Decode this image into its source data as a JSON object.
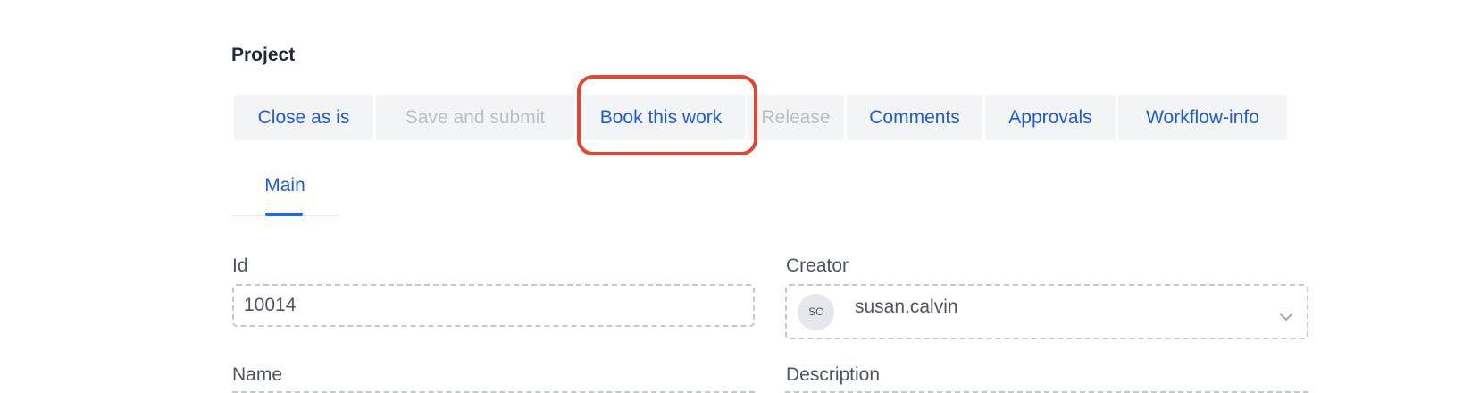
{
  "page": {
    "title": "Project"
  },
  "toolbar": {
    "buttons": [
      {
        "label": "Close as is",
        "enabled": true
      },
      {
        "label": "Save and submit",
        "enabled": false
      },
      {
        "label": "Book this work",
        "enabled": true,
        "highlighted": true
      },
      {
        "label": "Release",
        "enabled": false
      },
      {
        "label": "Comments",
        "enabled": true
      },
      {
        "label": "Approvals",
        "enabled": true
      },
      {
        "label": "Workflow-info",
        "enabled": true
      }
    ]
  },
  "tabs": [
    {
      "label": "Main",
      "active": true
    }
  ],
  "form": {
    "id": {
      "label": "Id",
      "value": "10014"
    },
    "creator": {
      "label": "Creator",
      "initials": "SC",
      "value": "susan.calvin"
    },
    "name": {
      "label": "Name",
      "value": ""
    },
    "description": {
      "label": "Description",
      "value": ""
    }
  },
  "colors": {
    "accent": "#1d5bd8",
    "disabled_text": "#b9bfc9",
    "highlight": "#e8432f"
  },
  "icons": {
    "creator_dropdown": "chevron-down-icon"
  }
}
